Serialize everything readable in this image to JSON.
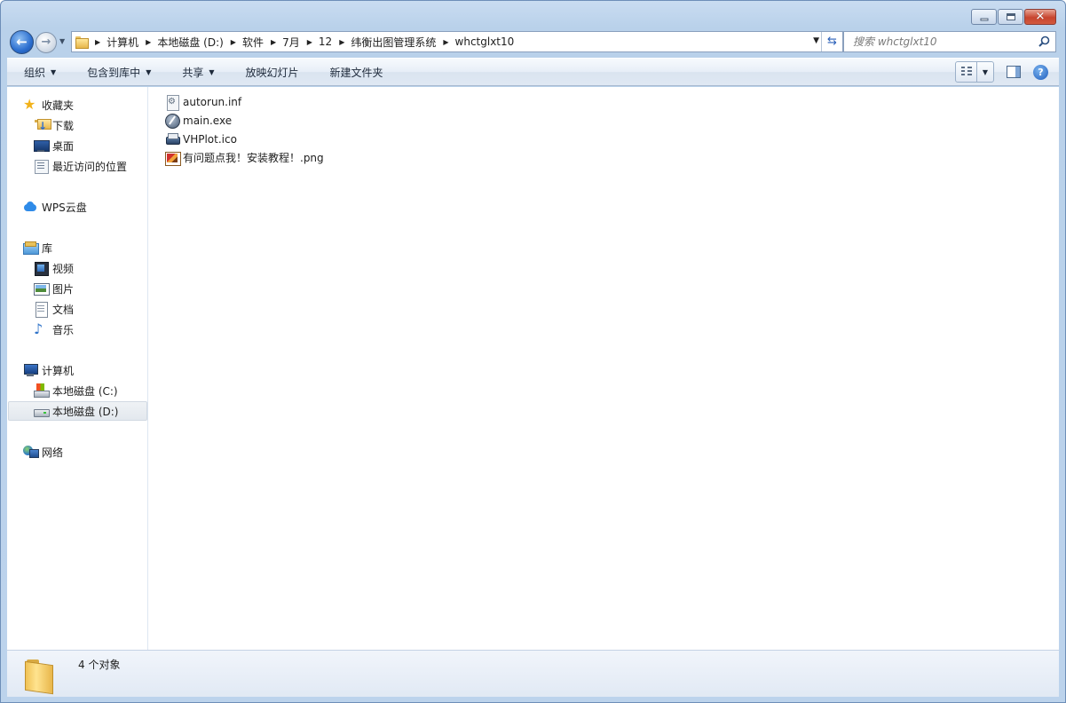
{
  "window": {
    "caption": {
      "minimize": "–",
      "maximize": "□",
      "close": "✕"
    }
  },
  "address": {
    "breadcrumbs": [
      "计算机",
      "本地磁盘 (D:)",
      "软件",
      "7月",
      "12",
      "纬衡出图管理系统",
      "whctglxt10"
    ]
  },
  "search": {
    "placeholder": "搜索 whctglxt10"
  },
  "toolbar": {
    "organize": "组织",
    "include_in_library": "包含到库中",
    "share": "共享",
    "slideshow": "放映幻灯片",
    "new_folder": "新建文件夹"
  },
  "nav": {
    "favorites": {
      "label": "收藏夹",
      "items": [
        "下载",
        "桌面",
        "最近访问的位置"
      ]
    },
    "wps_cloud": "WPS云盘",
    "libraries": {
      "label": "库",
      "items": [
        "视频",
        "图片",
        "文档",
        "音乐"
      ]
    },
    "computer": {
      "label": "计算机",
      "items": [
        "本地磁盘 (C:)",
        "本地磁盘 (D:)"
      ]
    },
    "network": "网络"
  },
  "files": [
    {
      "name": "autorun.inf",
      "icon": "inf-icon"
    },
    {
      "name": "main.exe",
      "icon": "exe-icon"
    },
    {
      "name": "VHPlot.ico",
      "icon": "ico-icon"
    },
    {
      "name": "有问题点我！安装教程！.png",
      "icon": "png-icon"
    }
  ],
  "status": {
    "item_count": "4 个对象"
  }
}
